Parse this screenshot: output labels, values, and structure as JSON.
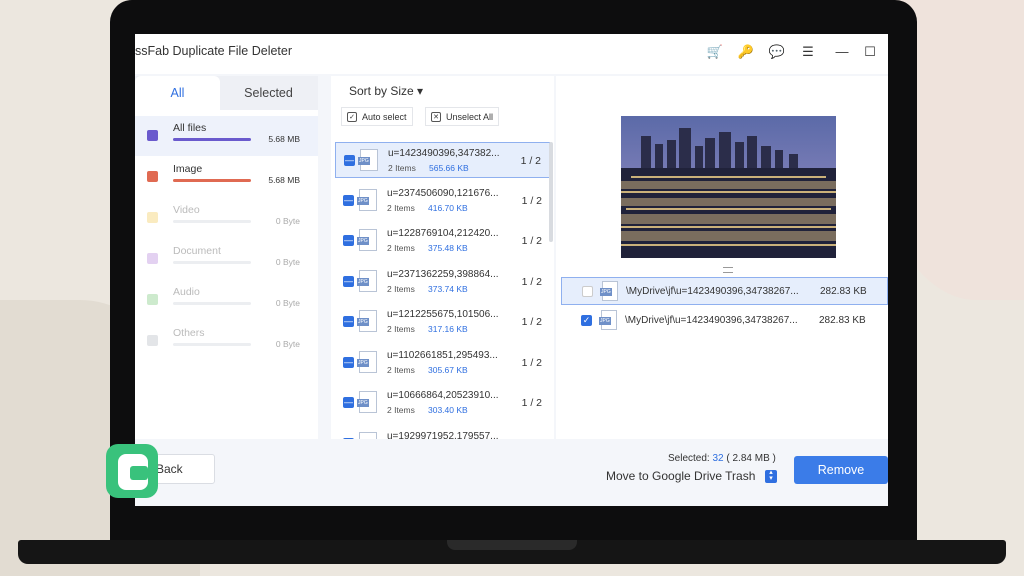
{
  "app": {
    "title": "ssFab Duplicate File Deleter"
  },
  "titlebar_icons": [
    "cart-icon",
    "key-icon",
    "feedback-icon",
    "menu-icon",
    "minimize-icon",
    "maximize-icon"
  ],
  "left": {
    "tabs": [
      {
        "label": "All",
        "active": true
      },
      {
        "label": "Selected",
        "active": false
      }
    ],
    "categories": [
      {
        "name": "All files",
        "size": "5.68 MB",
        "color": "#6a5acd",
        "progress": 1.0
      },
      {
        "name": "Image",
        "size": "5.68 MB",
        "color": "#e06a52",
        "progress": 1.0
      },
      {
        "name": "Video",
        "size": "0 Byte",
        "color": "#f0c64a",
        "progress": 0
      },
      {
        "name": "Document",
        "size": "0 Byte",
        "color": "#b07ad6",
        "progress": 0
      },
      {
        "name": "Audio",
        "size": "0 Byte",
        "color": "#6fc36f",
        "progress": 0
      },
      {
        "name": "Others",
        "size": "0 Byte",
        "color": "#b0b5bd",
        "progress": 0
      }
    ]
  },
  "middle": {
    "sort_label": "Sort by Size",
    "auto_select": "Auto select",
    "unselect_all": "Unselect All",
    "files": [
      {
        "name": "u=1423490396,347382...",
        "items": "2 Items",
        "size": "565.66 KB",
        "count": "1 / 2"
      },
      {
        "name": "u=2374506090,121676...",
        "items": "2 Items",
        "size": "416.70 KB",
        "count": "1 / 2"
      },
      {
        "name": "u=1228769104,212420...",
        "items": "2 Items",
        "size": "375.48 KB",
        "count": "1 / 2"
      },
      {
        "name": "u=2371362259,398864...",
        "items": "2 Items",
        "size": "373.74 KB",
        "count": "1 / 2"
      },
      {
        "name": "u=1212255675,101506...",
        "items": "2 Items",
        "size": "317.16 KB",
        "count": "1 / 2"
      },
      {
        "name": "u=1102661851,295493...",
        "items": "2 Items",
        "size": "305.67 KB",
        "count": "1 / 2"
      },
      {
        "name": "u=10666864,20523910...",
        "items": "2 Items",
        "size": "303.40 KB",
        "count": "1 / 2"
      },
      {
        "name": "u=1929971952,179557...",
        "items": "",
        "size": "",
        "count": ""
      }
    ],
    "file_type_label": "JPG"
  },
  "right": {
    "paths": [
      {
        "path": "\\MyDrive\\jf\\u=1423490396,34738267...",
        "size": "282.83 KB",
        "checked": false
      },
      {
        "path": "\\MyDrive\\jf\\u=1423490396,34738267...",
        "size": "282.83 KB",
        "checked": true
      }
    ]
  },
  "bottom": {
    "back_label": "Back",
    "selected_prefix": "Selected:",
    "selected_count": "32",
    "selected_size": "( 2.84 MB )",
    "move_option": "Move to Google Drive Trash",
    "remove_label": "Remove"
  },
  "colors": {
    "accent": "#2f6fe0",
    "remove": "#3b7ce8"
  }
}
